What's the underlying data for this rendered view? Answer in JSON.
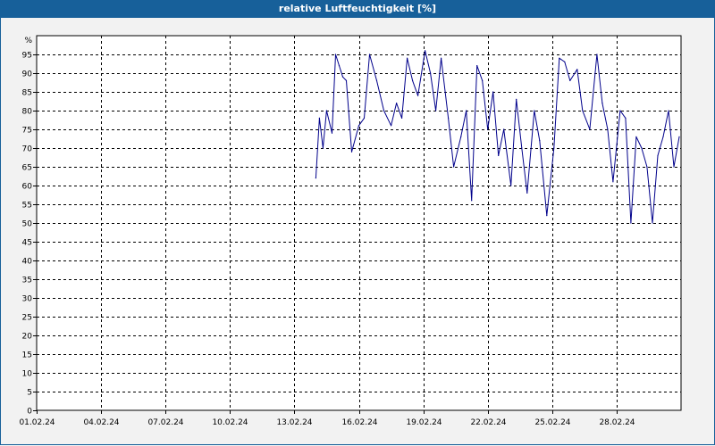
{
  "window": {
    "title": "relative Luftfeuchtigkeit [%]"
  },
  "chart_data": {
    "type": "line",
    "title": "relative Luftfeuchtigkeit [%]",
    "ylabel": "%",
    "ylim": [
      0,
      100
    ],
    "yticks": [
      0,
      5,
      10,
      15,
      20,
      25,
      30,
      35,
      40,
      45,
      50,
      55,
      60,
      65,
      70,
      75,
      80,
      85,
      90,
      95
    ],
    "xlim": [
      "2024-02-01",
      "2024-03-02"
    ],
    "xticks": [
      "01.02.24",
      "04.02.24",
      "07.02.24",
      "10.02.24",
      "13.02.24",
      "16.02.24",
      "19.02.24",
      "22.02.24",
      "25.02.24",
      "28.02.24"
    ],
    "grid": true,
    "series": [
      {
        "color": "#00008b",
        "x": [
          "2024-02-14T00:00",
          "2024-02-14T04:00",
          "2024-02-14T08:00",
          "2024-02-14T12:00",
          "2024-02-14T18:00",
          "2024-02-14T22:00",
          "2024-02-15T02:00",
          "2024-02-15T06:00",
          "2024-02-15T10:00",
          "2024-02-15T16:00",
          "2024-02-16T00:00",
          "2024-02-16T06:00",
          "2024-02-16T12:00",
          "2024-02-16T20:00",
          "2024-02-17T04:00",
          "2024-02-17T12:00",
          "2024-02-17T18:00",
          "2024-02-18T00:00",
          "2024-02-18T06:00",
          "2024-02-18T12:00",
          "2024-02-18T18:00",
          "2024-02-19T02:00",
          "2024-02-19T08:00",
          "2024-02-19T14:00",
          "2024-02-19T20:00",
          "2024-02-20T04:00",
          "2024-02-20T10:00",
          "2024-02-20T18:00",
          "2024-02-21T00:00",
          "2024-02-21T06:00",
          "2024-02-21T12:00",
          "2024-02-21T18:00",
          "2024-02-22T00:00",
          "2024-02-22T06:00",
          "2024-02-22T12:00",
          "2024-02-22T18:00",
          "2024-02-23T02:00",
          "2024-02-23T08:00",
          "2024-02-23T14:00",
          "2024-02-23T20:00",
          "2024-02-24T04:00",
          "2024-02-24T10:00",
          "2024-02-24T18:00",
          "2024-02-25T02:00",
          "2024-02-25T08:00",
          "2024-02-25T14:00",
          "2024-02-25T20:00",
          "2024-02-26T04:00",
          "2024-02-26T10:00",
          "2024-02-26T18:00",
          "2024-02-27T02:00",
          "2024-02-27T08:00",
          "2024-02-27T14:00",
          "2024-02-27T20:00",
          "2024-02-28T04:00",
          "2024-02-28T10:00",
          "2024-02-28T16:00",
          "2024-02-28T22:00",
          "2024-02-29T04:00",
          "2024-02-29T10:00",
          "2024-02-29T16:00",
          "2024-02-29T22:00",
          "2024-03-01T04:00",
          "2024-03-01T10:00",
          "2024-03-01T16:00",
          "2024-03-01T22:00"
        ],
        "values": [
          62,
          78,
          70,
          80,
          74,
          95,
          92,
          89,
          88,
          69,
          76,
          78,
          95,
          88,
          80,
          76,
          82,
          78,
          94,
          88,
          84,
          96,
          90,
          80,
          94,
          78,
          65,
          73,
          80,
          56,
          92,
          88,
          75,
          85,
          68,
          75,
          60,
          83,
          70,
          58,
          80,
          72,
          52,
          70,
          94,
          93,
          88,
          91,
          80,
          75,
          95,
          82,
          75,
          61,
          80,
          78,
          50,
          73,
          70,
          65,
          50,
          68,
          73,
          80,
          65,
          73
        ]
      }
    ]
  }
}
